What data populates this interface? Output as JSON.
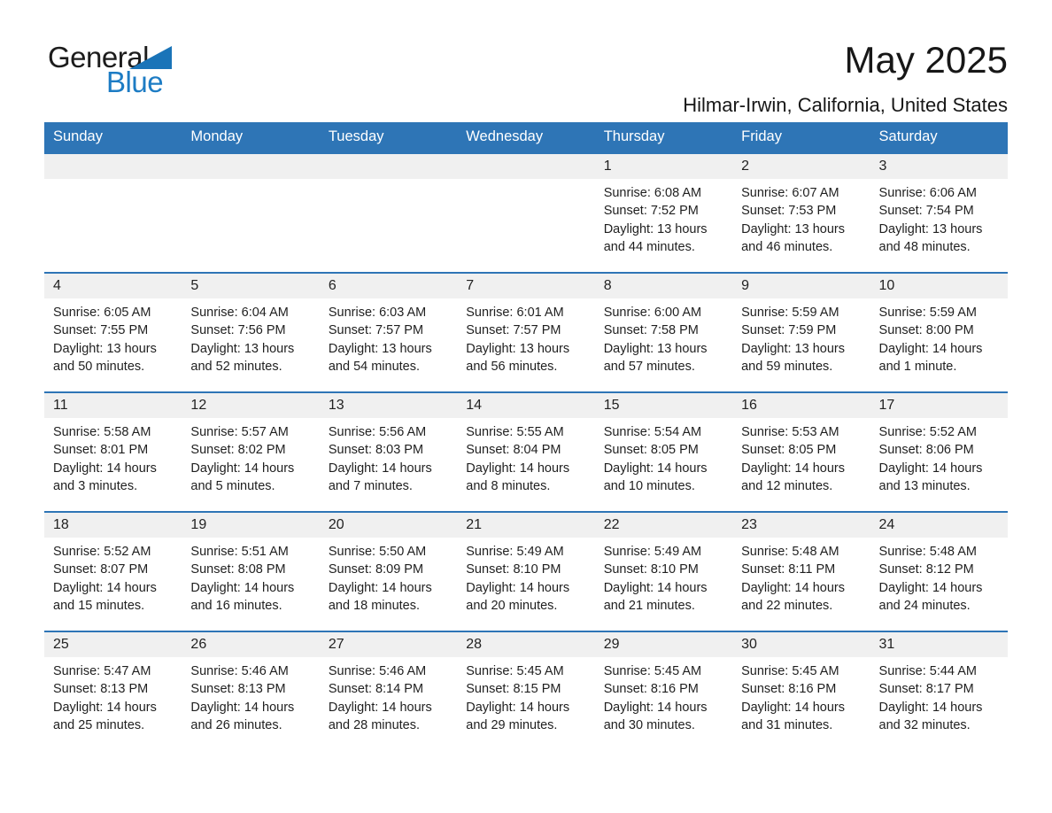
{
  "brand": {
    "name_part1": "General",
    "name_part2": "Blue"
  },
  "header": {
    "month_title": "May 2025",
    "location": "Hilmar-Irwin, California, United States"
  },
  "colors": {
    "header_blue": "#2e75b6",
    "logo_blue": "#1d7cc4",
    "daynum_band": "#f0f0f0"
  },
  "weekday_headers": [
    "Sunday",
    "Monday",
    "Tuesday",
    "Wednesday",
    "Thursday",
    "Friday",
    "Saturday"
  ],
  "weeks": [
    [
      {
        "day": "",
        "sunrise": "",
        "sunset": "",
        "daylight_line1": "",
        "daylight_line2": ""
      },
      {
        "day": "",
        "sunrise": "",
        "sunset": "",
        "daylight_line1": "",
        "daylight_line2": ""
      },
      {
        "day": "",
        "sunrise": "",
        "sunset": "",
        "daylight_line1": "",
        "daylight_line2": ""
      },
      {
        "day": "",
        "sunrise": "",
        "sunset": "",
        "daylight_line1": "",
        "daylight_line2": ""
      },
      {
        "day": "1",
        "sunrise": "Sunrise: 6:08 AM",
        "sunset": "Sunset: 7:52 PM",
        "daylight_line1": "Daylight: 13 hours",
        "daylight_line2": "and 44 minutes."
      },
      {
        "day": "2",
        "sunrise": "Sunrise: 6:07 AM",
        "sunset": "Sunset: 7:53 PM",
        "daylight_line1": "Daylight: 13 hours",
        "daylight_line2": "and 46 minutes."
      },
      {
        "day": "3",
        "sunrise": "Sunrise: 6:06 AM",
        "sunset": "Sunset: 7:54 PM",
        "daylight_line1": "Daylight: 13 hours",
        "daylight_line2": "and 48 minutes."
      }
    ],
    [
      {
        "day": "4",
        "sunrise": "Sunrise: 6:05 AM",
        "sunset": "Sunset: 7:55 PM",
        "daylight_line1": "Daylight: 13 hours",
        "daylight_line2": "and 50 minutes."
      },
      {
        "day": "5",
        "sunrise": "Sunrise: 6:04 AM",
        "sunset": "Sunset: 7:56 PM",
        "daylight_line1": "Daylight: 13 hours",
        "daylight_line2": "and 52 minutes."
      },
      {
        "day": "6",
        "sunrise": "Sunrise: 6:03 AM",
        "sunset": "Sunset: 7:57 PM",
        "daylight_line1": "Daylight: 13 hours",
        "daylight_line2": "and 54 minutes."
      },
      {
        "day": "7",
        "sunrise": "Sunrise: 6:01 AM",
        "sunset": "Sunset: 7:57 PM",
        "daylight_line1": "Daylight: 13 hours",
        "daylight_line2": "and 56 minutes."
      },
      {
        "day": "8",
        "sunrise": "Sunrise: 6:00 AM",
        "sunset": "Sunset: 7:58 PM",
        "daylight_line1": "Daylight: 13 hours",
        "daylight_line2": "and 57 minutes."
      },
      {
        "day": "9",
        "sunrise": "Sunrise: 5:59 AM",
        "sunset": "Sunset: 7:59 PM",
        "daylight_line1": "Daylight: 13 hours",
        "daylight_line2": "and 59 minutes."
      },
      {
        "day": "10",
        "sunrise": "Sunrise: 5:59 AM",
        "sunset": "Sunset: 8:00 PM",
        "daylight_line1": "Daylight: 14 hours",
        "daylight_line2": "and 1 minute."
      }
    ],
    [
      {
        "day": "11",
        "sunrise": "Sunrise: 5:58 AM",
        "sunset": "Sunset: 8:01 PM",
        "daylight_line1": "Daylight: 14 hours",
        "daylight_line2": "and 3 minutes."
      },
      {
        "day": "12",
        "sunrise": "Sunrise: 5:57 AM",
        "sunset": "Sunset: 8:02 PM",
        "daylight_line1": "Daylight: 14 hours",
        "daylight_line2": "and 5 minutes."
      },
      {
        "day": "13",
        "sunrise": "Sunrise: 5:56 AM",
        "sunset": "Sunset: 8:03 PM",
        "daylight_line1": "Daylight: 14 hours",
        "daylight_line2": "and 7 minutes."
      },
      {
        "day": "14",
        "sunrise": "Sunrise: 5:55 AM",
        "sunset": "Sunset: 8:04 PM",
        "daylight_line1": "Daylight: 14 hours",
        "daylight_line2": "and 8 minutes."
      },
      {
        "day": "15",
        "sunrise": "Sunrise: 5:54 AM",
        "sunset": "Sunset: 8:05 PM",
        "daylight_line1": "Daylight: 14 hours",
        "daylight_line2": "and 10 minutes."
      },
      {
        "day": "16",
        "sunrise": "Sunrise: 5:53 AM",
        "sunset": "Sunset: 8:05 PM",
        "daylight_line1": "Daylight: 14 hours",
        "daylight_line2": "and 12 minutes."
      },
      {
        "day": "17",
        "sunrise": "Sunrise: 5:52 AM",
        "sunset": "Sunset: 8:06 PM",
        "daylight_line1": "Daylight: 14 hours",
        "daylight_line2": "and 13 minutes."
      }
    ],
    [
      {
        "day": "18",
        "sunrise": "Sunrise: 5:52 AM",
        "sunset": "Sunset: 8:07 PM",
        "daylight_line1": "Daylight: 14 hours",
        "daylight_line2": "and 15 minutes."
      },
      {
        "day": "19",
        "sunrise": "Sunrise: 5:51 AM",
        "sunset": "Sunset: 8:08 PM",
        "daylight_line1": "Daylight: 14 hours",
        "daylight_line2": "and 16 minutes."
      },
      {
        "day": "20",
        "sunrise": "Sunrise: 5:50 AM",
        "sunset": "Sunset: 8:09 PM",
        "daylight_line1": "Daylight: 14 hours",
        "daylight_line2": "and 18 minutes."
      },
      {
        "day": "21",
        "sunrise": "Sunrise: 5:49 AM",
        "sunset": "Sunset: 8:10 PM",
        "daylight_line1": "Daylight: 14 hours",
        "daylight_line2": "and 20 minutes."
      },
      {
        "day": "22",
        "sunrise": "Sunrise: 5:49 AM",
        "sunset": "Sunset: 8:10 PM",
        "daylight_line1": "Daylight: 14 hours",
        "daylight_line2": "and 21 minutes."
      },
      {
        "day": "23",
        "sunrise": "Sunrise: 5:48 AM",
        "sunset": "Sunset: 8:11 PM",
        "daylight_line1": "Daylight: 14 hours",
        "daylight_line2": "and 22 minutes."
      },
      {
        "day": "24",
        "sunrise": "Sunrise: 5:48 AM",
        "sunset": "Sunset: 8:12 PM",
        "daylight_line1": "Daylight: 14 hours",
        "daylight_line2": "and 24 minutes."
      }
    ],
    [
      {
        "day": "25",
        "sunrise": "Sunrise: 5:47 AM",
        "sunset": "Sunset: 8:13 PM",
        "daylight_line1": "Daylight: 14 hours",
        "daylight_line2": "and 25 minutes."
      },
      {
        "day": "26",
        "sunrise": "Sunrise: 5:46 AM",
        "sunset": "Sunset: 8:13 PM",
        "daylight_line1": "Daylight: 14 hours",
        "daylight_line2": "and 26 minutes."
      },
      {
        "day": "27",
        "sunrise": "Sunrise: 5:46 AM",
        "sunset": "Sunset: 8:14 PM",
        "daylight_line1": "Daylight: 14 hours",
        "daylight_line2": "and 28 minutes."
      },
      {
        "day": "28",
        "sunrise": "Sunrise: 5:45 AM",
        "sunset": "Sunset: 8:15 PM",
        "daylight_line1": "Daylight: 14 hours",
        "daylight_line2": "and 29 minutes."
      },
      {
        "day": "29",
        "sunrise": "Sunrise: 5:45 AM",
        "sunset": "Sunset: 8:16 PM",
        "daylight_line1": "Daylight: 14 hours",
        "daylight_line2": "and 30 minutes."
      },
      {
        "day": "30",
        "sunrise": "Sunrise: 5:45 AM",
        "sunset": "Sunset: 8:16 PM",
        "daylight_line1": "Daylight: 14 hours",
        "daylight_line2": "and 31 minutes."
      },
      {
        "day": "31",
        "sunrise": "Sunrise: 5:44 AM",
        "sunset": "Sunset: 8:17 PM",
        "daylight_line1": "Daylight: 14 hours",
        "daylight_line2": "and 32 minutes."
      }
    ]
  ]
}
